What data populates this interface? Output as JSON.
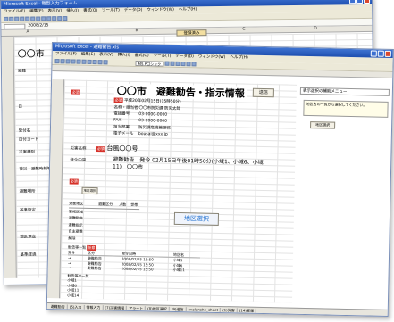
{
  "back_window": {
    "title": "Microsoft Excel - 雛型入力フォーム",
    "menu": [
      "ファイル(F)",
      "編集(E)",
      "表示(V)",
      "挿入(I)",
      "書式(O)",
      "ツール(T)",
      "データ(D)",
      "ウィンドウ(W)",
      "ヘルプ(H)"
    ],
    "formula_value": "2008/2/15",
    "columns": [
      "A",
      "B",
      "C",
      "D"
    ],
    "tab_label": "登録済み",
    "city": "〇〇市",
    "labels": [
      "避難",
      "日",
      "受付名",
      "日付ヨード",
      "災害種別",
      "被災・避難時刻等",
      "避難場所",
      "基準設定",
      "地区選定",
      "基準経過"
    ]
  },
  "front_window": {
    "title": "Microsoft Excel - 避難勧告.xls",
    "menu": [
      "ファイル(F)",
      "編集(E)",
      "表示(V)",
      "挿入(I)",
      "書式(O)",
      "ツール(T)",
      "データ(D)",
      "ウィンドウ(W)",
      "ヘルプ(H)"
    ],
    "font_box": "MS Pゴシック",
    "page_title": "〇〇市　避難勧告・指示情報",
    "send_button": "送信",
    "issue_date": "平成20年02月15日(15時50分)",
    "tags": {
      "required": "必須",
      "optional": "任意"
    },
    "info_rows": [
      {
        "label": "発信日時",
        "value": "平成20年02月15日 15時50分"
      },
      {
        "label": "名称・担当者",
        "value": "〇〇市防災課 防災太郎"
      },
      {
        "label": "電話番号",
        "value": "03-0000-0000"
      },
      {
        "label": "FAX",
        "value": "03-0000-0000"
      },
      {
        "label": "担当部署",
        "value": "防災課危機管理係"
      },
      {
        "label": "電子メール",
        "value": "bousai@xxx.jp"
      }
    ],
    "disaster_label": "災害名称",
    "disaster_value": "台風〇〇号",
    "content_label": "発令内容",
    "content_value": "避難勧告　発令 02月15日午後01時50分(小域1、小域6、小域11)　〇〇市",
    "area_button": "地区選択",
    "table_header": [
      "対象地区",
      "避難区分",
      "人数",
      "世帯"
    ],
    "table_rows": [
      "警戒区域",
      "避難勧告",
      "避難指示",
      "自主避難",
      "解除"
    ],
    "section_label": "勧告等一覧",
    "list_header": [
      "発令",
      "区分",
      "発令日時",
      "地区名"
    ],
    "list_rows": [
      [
        "→",
        "避難勧告",
        "2008/02/15 15:50",
        "小域1"
      ],
      [
        "→",
        "避難勧告",
        "2008/02/15 15:50",
        "小域6"
      ],
      [
        "→",
        "避難勧告",
        "2008/02/15 15:50",
        "小域11"
      ]
    ],
    "sub_label": "勧告等の一覧",
    "sub_rows": [
      "小域1",
      "小域6",
      "小域11",
      "小域14"
    ],
    "side_note_1": "表示選択の補助メニュー",
    "side_note_2": "地区名の一覧から選択してください。",
    "side_button": "地区選択",
    "tabs": [
      "避難勧告",
      "(5)入力",
      "情報入力",
      "(7)災害情報",
      "アラート",
      "(8)地区選択",
      "(9)送信",
      "avalanche_sheet",
      "(1)災害",
      "(14)警報"
    ],
    "status": "コマンド"
  },
  "colors": {
    "title_bar": "#2a5cc0",
    "required_tag": "#d6322a",
    "toolbar_bg": "#ece9d8"
  }
}
